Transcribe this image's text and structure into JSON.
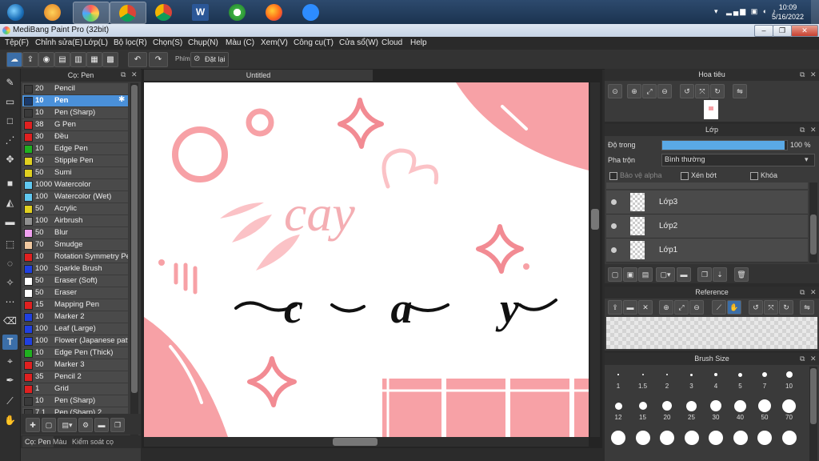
{
  "taskbar": {
    "clock_time": "10:09",
    "clock_date": "5/16/2022"
  },
  "window": {
    "title": "MediBang Paint Pro (32bit)"
  },
  "menu": [
    "Tệp(F)",
    "Chỉnh sửa(E)",
    "Lớp(L)",
    "Bộ lọc(R)",
    "Chọn(S)",
    "Chụp(N)",
    "Màu (C)",
    "Xem(V)",
    "Công cụ(T)",
    "Cửa sổ(W)",
    "Cloud",
    "Help"
  ],
  "toolbar": {
    "shortcut_label": "Phím",
    "reset_label": "Đặt lại"
  },
  "brush_panel": {
    "title": "Cọ: Pen",
    "brushes": [
      {
        "size": "20",
        "name": "Pencil",
        "color": "#3a3a3a"
      },
      {
        "size": "10",
        "name": "Pen",
        "color": "#1a3a6a",
        "selected": true
      },
      {
        "size": "10",
        "name": "Pen (Sharp)",
        "color": "#3a3a3a"
      },
      {
        "size": "38",
        "name": "G Pen",
        "color": "#e02020"
      },
      {
        "size": "30",
        "name": "Đều",
        "color": "#e02020"
      },
      {
        "size": "10",
        "name": "Edge Pen",
        "color": "#20b020"
      },
      {
        "size": "50",
        "name": "Stipple Pen",
        "color": "#e0d020"
      },
      {
        "size": "50",
        "name": "Sumi",
        "color": "#e0d020"
      },
      {
        "size": "1000",
        "name": "Watercolor",
        "color": "#60c8f0"
      },
      {
        "size": "100",
        "name": "Watercolor (Wet)",
        "color": "#60c8f0"
      },
      {
        "size": "50",
        "name": "Acrylic",
        "color": "#e0d020"
      },
      {
        "size": "100",
        "name": "Airbrush",
        "color": "#909090"
      },
      {
        "size": "50",
        "name": "Blur",
        "color": "#f0a0f0"
      },
      {
        "size": "70",
        "name": "Smudge",
        "color": "#f0c8a0"
      },
      {
        "size": "10",
        "name": "Rotation Symmetry Pe",
        "color": "#e02020"
      },
      {
        "size": "100",
        "name": "Sparkle Brush",
        "color": "#2040e0"
      },
      {
        "size": "50",
        "name": "Eraser (Soft)",
        "color": "#ffffff"
      },
      {
        "size": "50",
        "name": "Eraser",
        "color": "#ffffff"
      },
      {
        "size": "15",
        "name": "Mapping Pen",
        "color": "#e02020"
      },
      {
        "size": "10",
        "name": "Marker 2",
        "color": "#2040e0"
      },
      {
        "size": "100",
        "name": "Leaf (Large)",
        "color": "#2040e0"
      },
      {
        "size": "100",
        "name": "Flower (Japanese patt",
        "color": "#2040e0"
      },
      {
        "size": "10",
        "name": "Edge Pen (Thick)",
        "color": "#20b020"
      },
      {
        "size": "50",
        "name": "Marker 3",
        "color": "#e02020"
      },
      {
        "size": "35",
        "name": "Pencil 2",
        "color": "#e02020"
      },
      {
        "size": "1",
        "name": "Grid",
        "color": "#e02020"
      },
      {
        "size": "10",
        "name": "Pen (Sharp)",
        "color": "#3a3a3a"
      },
      {
        "size": "7.1",
        "name": "Pen (Sharp) 2",
        "color": "#3a3a3a"
      }
    ],
    "tabs": [
      "Cọ: Pen",
      "Màu",
      "Kiểm soát cọ"
    ]
  },
  "document": {
    "tab_title": "Untitled",
    "text_pink": "cay",
    "text_black": "c a y",
    "colors": {
      "pink": "#f7a1a6",
      "black": "#111111"
    }
  },
  "navigator": {
    "title": "Hoa tiêu"
  },
  "layers": {
    "title": "Lớp",
    "opacity_label": "Độ trong",
    "opacity_value": 100,
    "opacity_text": "100 %",
    "blend_label": "Pha trộn",
    "blend_value": "Bình thường",
    "protect_alpha": "Bảo vệ alpha",
    "clipping": "Xén bớt",
    "lock": "Khóa",
    "items": [
      "Lớp3",
      "Lớp2",
      "Lớp1"
    ]
  },
  "reference": {
    "title": "Reference"
  },
  "brush_size": {
    "title": "Brush Size",
    "sizes": [
      "1",
      "1.5",
      "2",
      "3",
      "4",
      "5",
      "7",
      "10",
      "12",
      "15",
      "20",
      "25",
      "30",
      "40",
      "50",
      "70"
    ]
  },
  "colors": {
    "accent": "#4a90d9",
    "opacity_bar": "#5aa9e6"
  }
}
